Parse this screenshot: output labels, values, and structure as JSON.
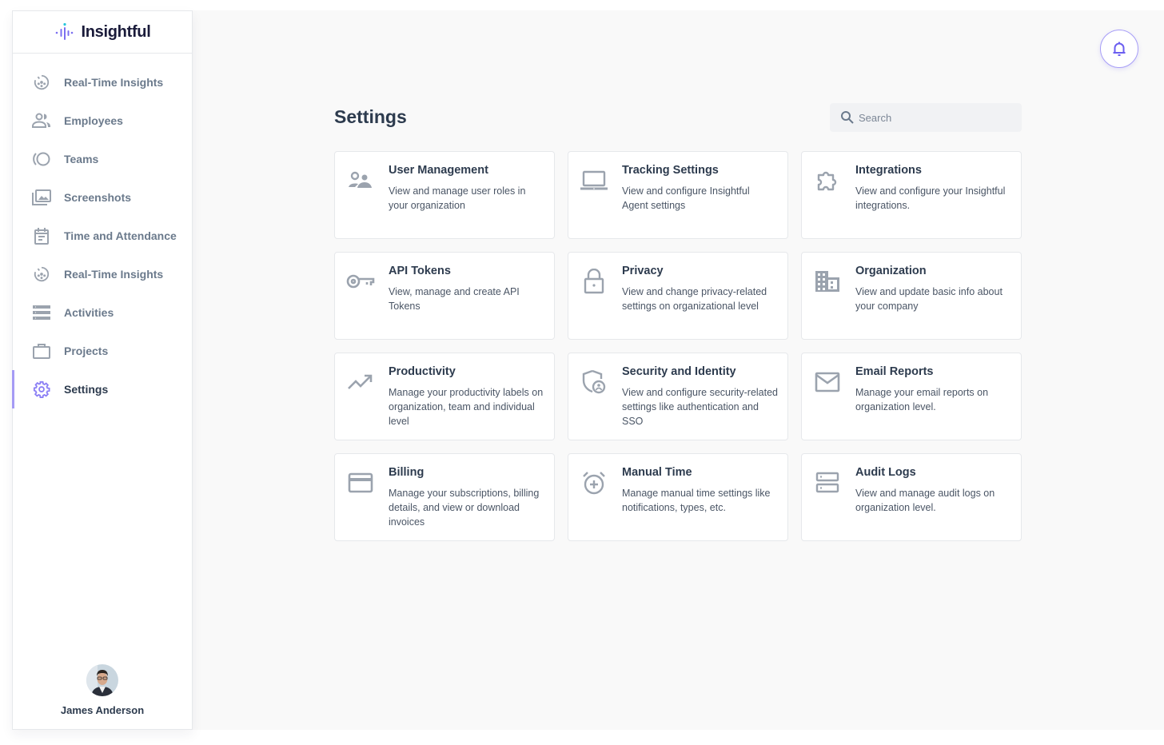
{
  "app": {
    "logo_text": "Insightful"
  },
  "sidebar": {
    "items": [
      {
        "label": "Real-Time Insights",
        "icon": "realtime-icon",
        "active": false
      },
      {
        "label": "Employees",
        "icon": "employees-icon",
        "active": false
      },
      {
        "label": "Teams",
        "icon": "teams-icon",
        "active": false
      },
      {
        "label": "Screenshots",
        "icon": "screenshots-icon",
        "active": false
      },
      {
        "label": "Time and Attendance",
        "icon": "calendar-icon",
        "active": false
      },
      {
        "label": "Real-Time Insights",
        "icon": "realtime-icon",
        "active": false
      },
      {
        "label": "Activities",
        "icon": "activities-icon",
        "active": false
      },
      {
        "label": "Projects",
        "icon": "briefcase-icon",
        "active": false
      },
      {
        "label": "Settings",
        "icon": "gear-icon",
        "active": true
      }
    ],
    "user": {
      "name": "James Anderson"
    }
  },
  "header": {
    "title": "Settings",
    "search_placeholder": "Search",
    "search_value": ""
  },
  "colors": {
    "accent": "#7b6ff0",
    "active_bar": "#a59bf5",
    "icon_gray": "#9ba3ae",
    "text_dark": "#2d3b4e"
  },
  "cards": [
    {
      "title": "User Management",
      "description": "View and manage user roles in your organization",
      "icon": "users-icon"
    },
    {
      "title": "Tracking Settings",
      "description": "View and configure Insightful Agent settings",
      "icon": "laptop-icon"
    },
    {
      "title": "Integrations",
      "description": "View and configure your Insightful integrations.",
      "icon": "puzzle-icon"
    },
    {
      "title": "API Tokens",
      "description": "View, manage and create API Tokens",
      "icon": "key-icon"
    },
    {
      "title": "Privacy",
      "description": "View and change privacy-related settings on organizational level",
      "icon": "lock-icon"
    },
    {
      "title": "Organization",
      "description": "View and update basic info about your company",
      "icon": "building-icon"
    },
    {
      "title": "Productivity",
      "description": "Manage your productivity labels on organization, team and individual level",
      "icon": "trending-up-icon"
    },
    {
      "title": "Security and Identity",
      "description": "View and configure security-related settings like authentication and SSO",
      "icon": "shield-user-icon"
    },
    {
      "title": "Email Reports",
      "description": "Manage your email reports on organization level.",
      "icon": "mail-icon"
    },
    {
      "title": "Billing",
      "description": "Manage your subscriptions, billing details, and view or download invoices",
      "icon": "credit-card-icon"
    },
    {
      "title": "Manual Time",
      "description": "Manage manual time settings like notifications, types, etc.",
      "icon": "alarm-add-icon"
    },
    {
      "title": "Audit Logs",
      "description": "View and manage audit logs on organization level.",
      "icon": "server-icon"
    }
  ]
}
